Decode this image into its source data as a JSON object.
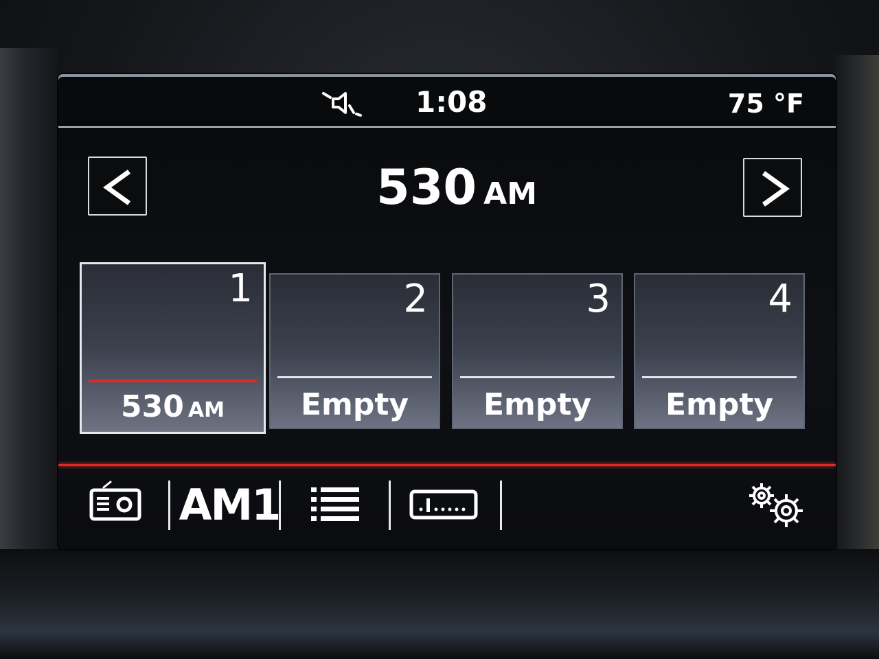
{
  "status": {
    "time": "1:08",
    "temperature": "75 °F",
    "mute_icon": "speaker-muted-icon"
  },
  "header": {
    "frequency": "530",
    "band": "AM",
    "prev_icon": "chevron-left-icon",
    "next_icon": "chevron-right-icon"
  },
  "presets": [
    {
      "number": "1",
      "freq": "530",
      "band": "AM",
      "selected": true
    },
    {
      "number": "2",
      "label": "Empty"
    },
    {
      "number": "3",
      "label": "Empty"
    },
    {
      "number": "4",
      "label": "Empty"
    }
  ],
  "toolbar": {
    "source_icon": "radio-icon",
    "band_label": "AM1",
    "list_icon": "list-icon",
    "tuner_icon": "manual-tuner-icon",
    "settings_icon": "gears-icon"
  },
  "colors": {
    "accent": "#e32626",
    "text": "#ffffff",
    "divider": "#c9ccd2"
  }
}
